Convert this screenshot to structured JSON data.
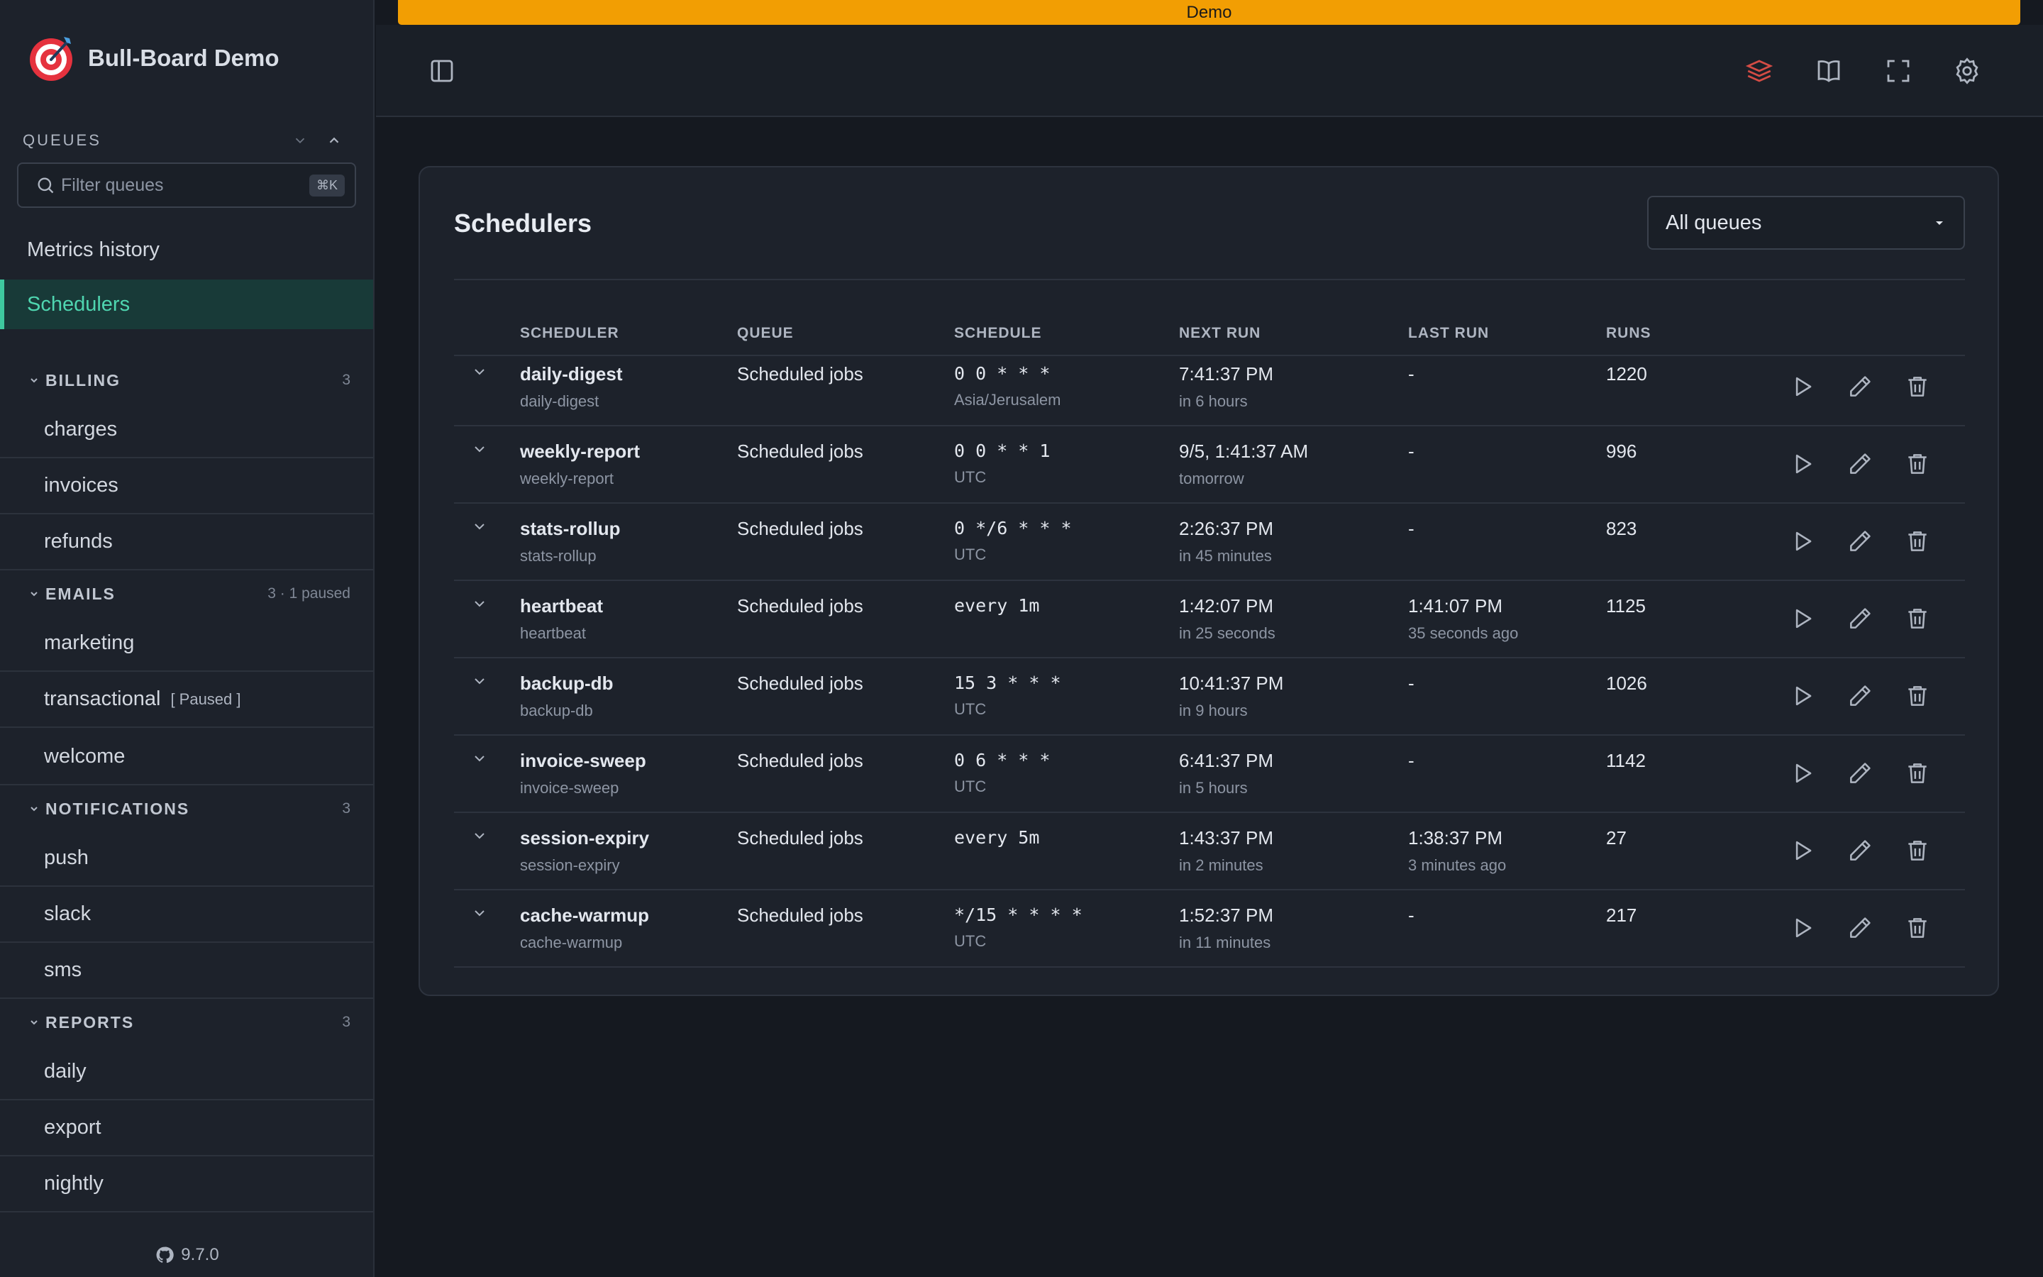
{
  "app": {
    "title": "Bull-Board Demo",
    "version": "9.7.0",
    "demo_label": "Demo"
  },
  "colors": {
    "accent": "#3ec99f",
    "demo_bar": "#f29e03",
    "background": "#151920",
    "sidebar": "#1d222b"
  },
  "sidebar": {
    "queues_title": "QUEUES",
    "filter_placeholder": "Filter queues",
    "filter_shortcut": "⌘K",
    "links": [
      {
        "label": "Metrics history",
        "active": false
      },
      {
        "label": "Schedulers",
        "active": true
      }
    ],
    "groups": [
      {
        "name": "BILLING",
        "count": "3",
        "items": [
          {
            "label": "charges"
          },
          {
            "label": "invoices"
          },
          {
            "label": "refunds"
          }
        ]
      },
      {
        "name": "EMAILS",
        "count": "3 · 1 paused",
        "items": [
          {
            "label": "marketing"
          },
          {
            "label": "transactional",
            "tag": "[ Paused ]"
          },
          {
            "label": "welcome"
          }
        ]
      },
      {
        "name": "NOTIFICATIONS",
        "count": "3",
        "items": [
          {
            "label": "push"
          },
          {
            "label": "slack"
          },
          {
            "label": "sms"
          }
        ]
      },
      {
        "name": "REPORTS",
        "count": "3",
        "items": [
          {
            "label": "daily"
          },
          {
            "label": "export"
          },
          {
            "label": "nightly"
          }
        ]
      }
    ]
  },
  "topbar": {
    "icons": [
      "redis-icon",
      "book-icon",
      "fullscreen-icon",
      "gear-icon"
    ]
  },
  "main": {
    "title": "Schedulers",
    "queue_filter": "All queues",
    "columns": [
      "SCHEDULER",
      "QUEUE",
      "SCHEDULE",
      "NEXT RUN",
      "LAST RUN",
      "RUNS"
    ],
    "rows": [
      {
        "name": "daily-digest",
        "id": "daily-digest",
        "queue": "Scheduled jobs",
        "schedule": "0 0 * * *",
        "tz": "Asia/Jerusalem",
        "next": "7:41:37 PM",
        "next_rel": "in 6 hours",
        "last": "-",
        "last_rel": "",
        "runs": "1220"
      },
      {
        "name": "weekly-report",
        "id": "weekly-report",
        "queue": "Scheduled jobs",
        "schedule": "0 0 * * 1",
        "tz": "UTC",
        "next": "9/5, 1:41:37 AM",
        "next_rel": "tomorrow",
        "last": "-",
        "last_rel": "",
        "runs": "996"
      },
      {
        "name": "stats-rollup",
        "id": "stats-rollup",
        "queue": "Scheduled jobs",
        "schedule": "0 */6 * * *",
        "tz": "UTC",
        "next": "2:26:37 PM",
        "next_rel": "in 45 minutes",
        "last": "-",
        "last_rel": "",
        "runs": "823"
      },
      {
        "name": "heartbeat",
        "id": "heartbeat",
        "queue": "Scheduled jobs",
        "schedule": "every 1m",
        "tz": "",
        "next": "1:42:07 PM",
        "next_rel": "in 25 seconds",
        "last": "1:41:07 PM",
        "last_rel": "35 seconds ago",
        "runs": "1125"
      },
      {
        "name": "backup-db",
        "id": "backup-db",
        "queue": "Scheduled jobs",
        "schedule": "15 3 * * *",
        "tz": "UTC",
        "next": "10:41:37 PM",
        "next_rel": "in 9 hours",
        "last": "-",
        "last_rel": "",
        "runs": "1026"
      },
      {
        "name": "invoice-sweep",
        "id": "invoice-sweep",
        "queue": "Scheduled jobs",
        "schedule": "0 6 * * *",
        "tz": "UTC",
        "next": "6:41:37 PM",
        "next_rel": "in 5 hours",
        "last": "-",
        "last_rel": "",
        "runs": "1142"
      },
      {
        "name": "session-expiry",
        "id": "session-expiry",
        "queue": "Scheduled jobs",
        "schedule": "every 5m",
        "tz": "",
        "next": "1:43:37 PM",
        "next_rel": "in 2 minutes",
        "last": "1:38:37 PM",
        "last_rel": "3 minutes ago",
        "runs": "27"
      },
      {
        "name": "cache-warmup",
        "id": "cache-warmup",
        "queue": "Scheduled jobs",
        "schedule": "*/15 * * * *",
        "tz": "UTC",
        "next": "1:52:37 PM",
        "next_rel": "in 11 minutes",
        "last": "-",
        "last_rel": "",
        "runs": "217"
      }
    ]
  }
}
